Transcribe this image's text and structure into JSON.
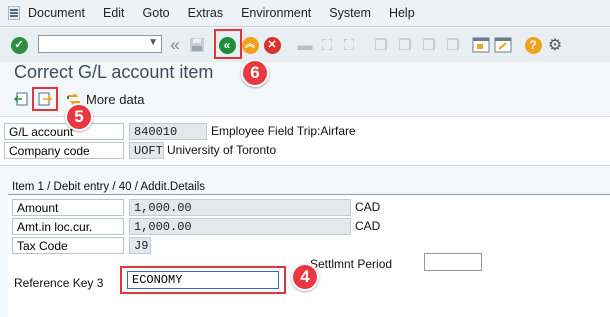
{
  "menu": [
    "Document",
    "Edit",
    "Goto",
    "Extras",
    "Environment",
    "System",
    "Help"
  ],
  "title": "Correct G/L account item",
  "toolbar": {
    "more_data": "More data"
  },
  "header": {
    "gl_label": "G/L account",
    "gl_value": "840010",
    "gl_desc": "Employee Field Trip:Airfare",
    "cc_label": "Company code",
    "cc_value": "UOFT",
    "cc_desc": "University of Toronto"
  },
  "item": {
    "section_title": "Item 1 / Debit entry / 40 / Addit.Details",
    "amount_label": "Amount",
    "amount_value": "1,000.00",
    "amount_cur": "CAD",
    "loc_label": "Amt.in loc.cur.",
    "loc_value": "1,000.00",
    "loc_cur": "CAD",
    "tax_label": "Tax Code",
    "tax_value": "J9",
    "settl_label": "Settlmnt Period",
    "refkey3_label": "Reference Key 3",
    "refkey3_value": "ECONOMY"
  },
  "annotations": {
    "m4": "4",
    "m5": "5",
    "m6": "6"
  },
  "colors": {
    "marker_red": "#e7393f",
    "green_ok": "#2f8f3f",
    "back_green": "#1d8f3a",
    "cancel_red": "#d7352b"
  }
}
